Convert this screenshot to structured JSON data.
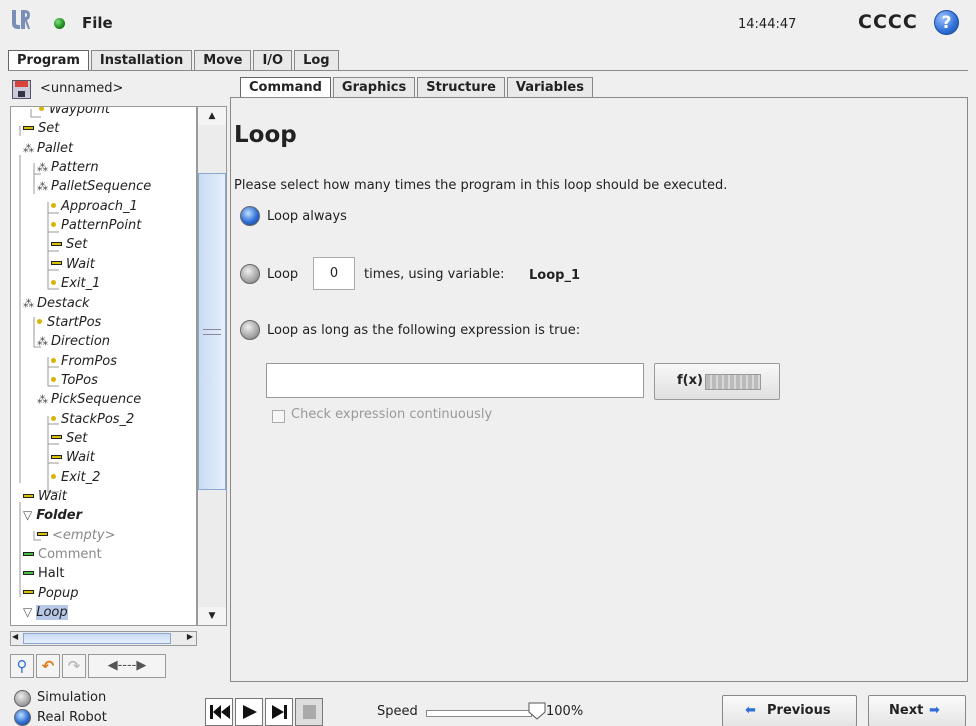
{
  "header": {
    "file_label": "File",
    "clock": "14:44:47",
    "robot_name": "CCCC",
    "help_label": "?"
  },
  "top_tabs": [
    "Program",
    "Installation",
    "Move",
    "I/O",
    "Log"
  ],
  "program": {
    "name": "<unnamed>"
  },
  "tree": [
    {
      "label": "Waypoint",
      "icon": "waypoint"
    },
    {
      "label": "Set",
      "icon": "bar"
    },
    {
      "label": "Pallet",
      "icon": "dots"
    },
    {
      "label": "Pattern",
      "icon": "dots"
    },
    {
      "label": "PalletSequence",
      "icon": "dots"
    },
    {
      "label": "Approach_1",
      "icon": "waypoint"
    },
    {
      "label": "PatternPoint",
      "icon": "waypoint"
    },
    {
      "label": "Set",
      "icon": "bar"
    },
    {
      "label": "Wait",
      "icon": "bar"
    },
    {
      "label": "Exit_1",
      "icon": "waypoint"
    },
    {
      "label": "Destack",
      "icon": "dots"
    },
    {
      "label": "StartPos",
      "icon": "waypoint"
    },
    {
      "label": "Direction",
      "icon": "dots"
    },
    {
      "label": "FromPos",
      "icon": "waypoint"
    },
    {
      "label": "ToPos",
      "icon": "waypoint"
    },
    {
      "label": "PickSequence",
      "icon": "dots"
    },
    {
      "label": "StackPos_2",
      "icon": "waypoint"
    },
    {
      "label": "Set",
      "icon": "bar"
    },
    {
      "label": "Wait",
      "icon": "bar"
    },
    {
      "label": "Exit_2",
      "icon": "waypoint"
    },
    {
      "label": "Wait",
      "icon": "bar"
    },
    {
      "label": "Folder",
      "icon": "triangle"
    },
    {
      "label": "<empty>",
      "icon": "bar"
    },
    {
      "label": "Comment",
      "icon": "bar-green"
    },
    {
      "label": "Halt",
      "icon": "bar-green"
    },
    {
      "label": "Popup",
      "icon": "bar"
    },
    {
      "label": "Loop",
      "icon": "triangle",
      "selected": true
    }
  ],
  "toolbar": {
    "search_icon": "search-icon",
    "undo_icon": "undo-icon",
    "redo_icon": "redo-icon",
    "move_icon": "move-arrows-icon"
  },
  "sub_tabs": [
    "Command",
    "Graphics",
    "Structure",
    "Variables"
  ],
  "command": {
    "title": "Loop",
    "prompt": "Please select how many times the program in this loop should be executed.",
    "option_always": "Loop always",
    "option_times_prefix": "Loop",
    "loop_count": "0",
    "option_times_suffix": "times, using variable:",
    "variable_name": "Loop_1",
    "option_expression": "Loop as long as the following expression is true:",
    "expression_value": "",
    "fx_label": "f(x)",
    "check_continuous": "Check expression continuously",
    "selected_option": "always"
  },
  "footer": {
    "mode_simulation": "Simulation",
    "mode_real": "Real Robot",
    "speed_label": "Speed",
    "speed_value": "100%",
    "speed_fraction": 1.0,
    "previous": "Previous",
    "next": "Next"
  },
  "colors": {
    "accent_blue": "#2f6fd6",
    "selection": "#b8c8e8",
    "waypoint": "#d8b400"
  }
}
